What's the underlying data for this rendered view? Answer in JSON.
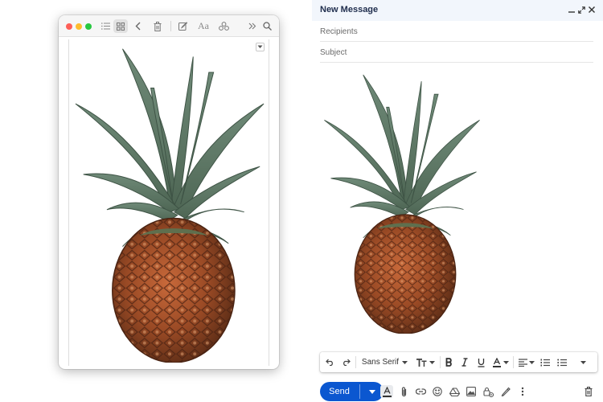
{
  "compose": {
    "title": "New Message",
    "recipients_placeholder": "Recipients",
    "subject_placeholder": "Subject",
    "send_label": "Send"
  },
  "format_toolbar": {
    "font_family": "Sans Serif",
    "icons": [
      "undo-icon",
      "redo-icon",
      "font-size-icon",
      "bold-icon",
      "italic-icon",
      "underline-icon",
      "text-color-icon",
      "align-icon",
      "numbered-list-icon",
      "bulleted-list-icon",
      "more-formatting-icon"
    ]
  },
  "bottom_toolbar": {
    "icons": [
      "formatting-options-icon",
      "attach-icon",
      "link-icon",
      "emoji-icon",
      "drive-icon",
      "photo-icon",
      "confidential-icon",
      "signature-icon",
      "more-options-icon",
      "discard-icon"
    ]
  },
  "notes_toolbar": {
    "icons": [
      "list-view-icon",
      "gallery-view-icon",
      "back-icon",
      "trash-icon",
      "compose-icon",
      "text-format-icon",
      "share-icon",
      "more-icon",
      "search-icon"
    ],
    "font_label": "Aa"
  },
  "colors": {
    "send_blue": "#0b57d0",
    "header_bg": "#f2f6fc",
    "title_text": "#1f2d4d"
  }
}
